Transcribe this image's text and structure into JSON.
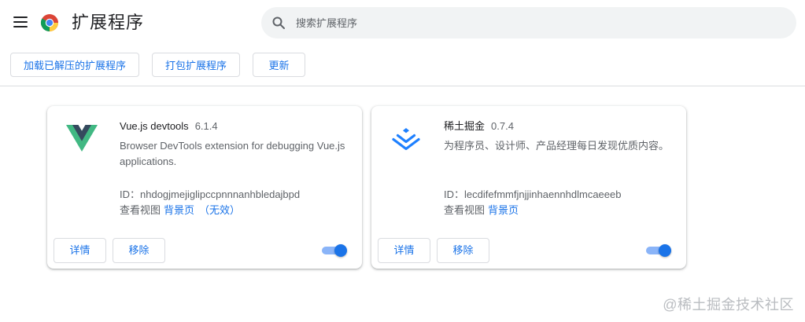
{
  "header": {
    "title": "扩展程序",
    "search_placeholder": "搜索扩展程序"
  },
  "toolbar": {
    "load_unpacked": "加载已解压的扩展程序",
    "pack": "打包扩展程序",
    "update": "更新"
  },
  "extensions": [
    {
      "name": "Vue.js devtools",
      "version": "6.1.4",
      "description": "Browser DevTools extension for debugging Vue.js applications.",
      "id_label": "ID：",
      "id": "nhdogjmejiglipccpnnnanhbledajbpd",
      "inspect_label": "查看视图",
      "view_link": "背景页",
      "view_extra": "（无效）",
      "details_label": "详情",
      "remove_label": "移除",
      "enabled": true,
      "logo_colors": {
        "outer": "#41b883",
        "inner": "#35495e"
      }
    },
    {
      "name": "稀土掘金",
      "version": "0.7.4",
      "description": "为程序员、设计师、产品经理每日发现优质内容。",
      "id_label": "ID：",
      "id": "lecdifefmmfjnjjinhaennhdlmcaeeeb",
      "inspect_label": "查看视图",
      "view_link": "背景页",
      "view_extra": "",
      "details_label": "详情",
      "remove_label": "移除",
      "enabled": true,
      "logo_colors": {
        "main": "#1e80ff"
      }
    }
  ],
  "watermark": "@稀土掘金技术社区",
  "colors": {
    "accent": "#1a73e8",
    "toggle_track": "#8ab4f8",
    "search_bg": "#f1f3f4"
  },
  "icons": [
    "menu-icon",
    "chrome-logo",
    "search-icon",
    "vue-logo",
    "juejin-logo",
    "toggle"
  ]
}
